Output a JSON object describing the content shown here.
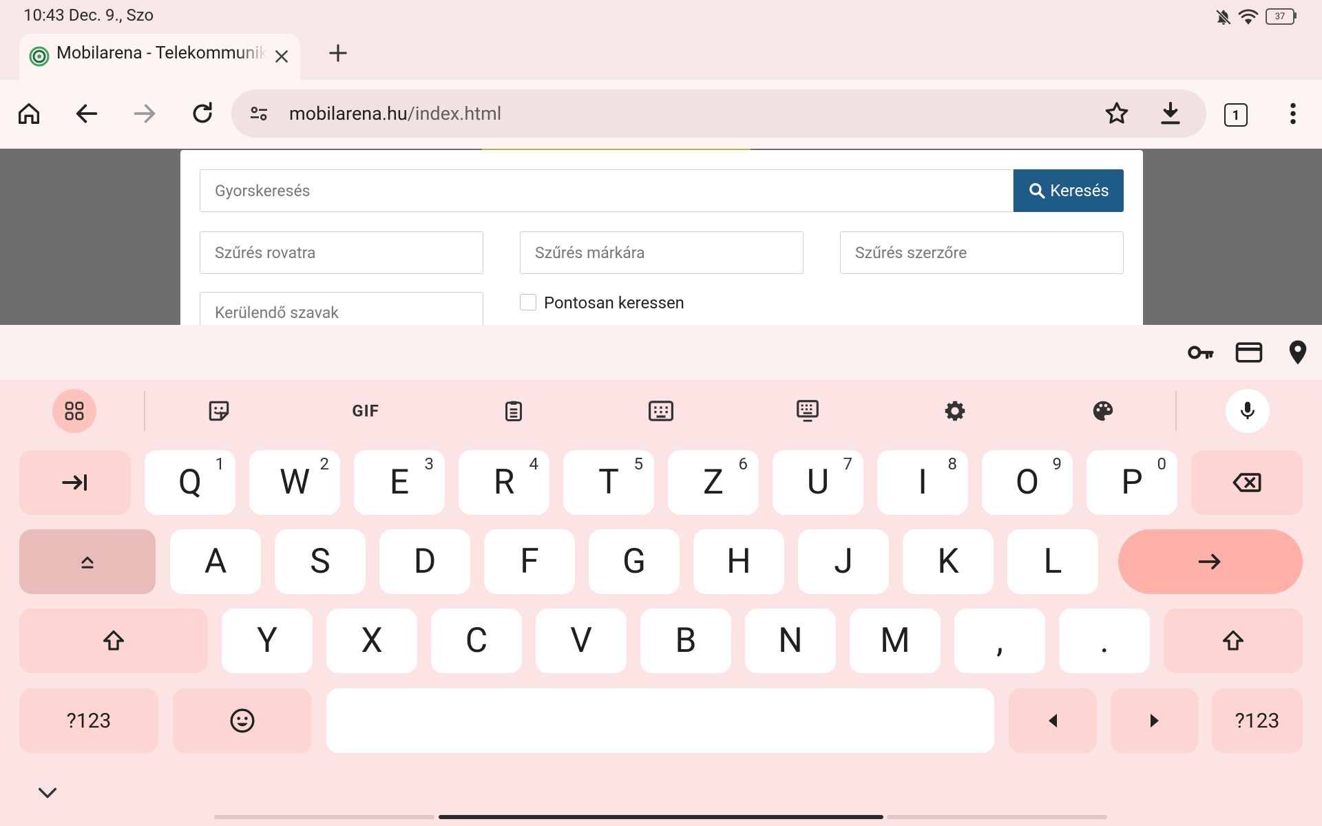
{
  "status_bar": {
    "time": "10:43 Dec. 9., Szo",
    "battery": "37"
  },
  "browser": {
    "tab": {
      "title": "Mobilarena - Telekommunikáció"
    },
    "url": {
      "host": "mobilarena.hu",
      "path": "/index.html"
    },
    "tab_count": "1"
  },
  "search_form": {
    "quick_search_placeholder": "Gyorskeresés",
    "search_button": "Keresés",
    "filter_section_placeholder": "Szűrés rovatra",
    "filter_brand_placeholder": "Szűrés márkára",
    "filter_author_placeholder": "Szűrés szerzőre",
    "exclude_words_placeholder": "Kerülendő szavak",
    "exact_match_label": "Pontosan keressen"
  },
  "keyboard": {
    "toolbar": {
      "gif_label": "GIF"
    },
    "row1": [
      {
        "label": "Q",
        "hint": "1"
      },
      {
        "label": "W",
        "hint": "2"
      },
      {
        "label": "E",
        "hint": "3"
      },
      {
        "label": "R",
        "hint": "4"
      },
      {
        "label": "T",
        "hint": "5"
      },
      {
        "label": "Z",
        "hint": "6"
      },
      {
        "label": "U",
        "hint": "7"
      },
      {
        "label": "I",
        "hint": "8"
      },
      {
        "label": "O",
        "hint": "9"
      },
      {
        "label": "P",
        "hint": "0"
      }
    ],
    "row2": [
      "A",
      "S",
      "D",
      "F",
      "G",
      "H",
      "J",
      "K",
      "L"
    ],
    "row3": [
      "Y",
      "X",
      "C",
      "V",
      "B",
      "N",
      "M",
      ",",
      "."
    ],
    "symbols_label": "?123",
    "colors": {
      "letter_key": "#ffffff",
      "function_key": "#fdd6d3",
      "enter_key": "#fdb1a7",
      "caps_key": "#e8bcb9",
      "background": "#fbe4e3"
    }
  }
}
